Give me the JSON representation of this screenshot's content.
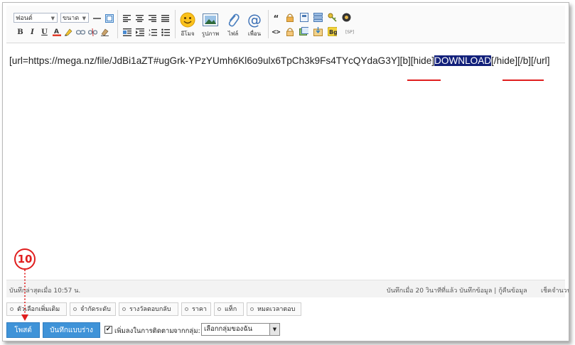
{
  "toolbar": {
    "font_select": "ฟอนต์",
    "size_select": "ขนาด",
    "emoticon_label": "อีโมจ",
    "image_label": "รูปภาพ",
    "file_label": "ไฟล์",
    "mention_label": "เพื่อน",
    "sp_label": "[SP]",
    "bg_label": "Bg"
  },
  "editor": {
    "code_before": "[url=https://mega.nz/file/JdBi1aZT#ugGrk-YPzYUmh6Kl6o9ulx6TpCh3k9Fs4TYcQYdaG3Y]",
    "tag_b_hide": "[b][hide]",
    "selected_text": "DOWNLOAD",
    "tag_close_hide_b": "[/hide][/b]",
    "tag_close_url": "[/url]"
  },
  "status": {
    "last_saved": "บันทึกล่าสุดเมื่อ 10:57 น.",
    "saved_info": "บันทึกเมื่อ 20 วินาทีที่แล้ว บันทึกข้อมูล | กู้คืนข้อมูล",
    "char_count": "เช็คจำนวน"
  },
  "options": [
    "ตัวเลือกเพิ่มเติม",
    "จำกัดระดับ",
    "รางวัลตอบกลับ",
    "ราคา",
    "แท็ก",
    "หมดเวลาตอบ"
  ],
  "actions": {
    "post_button": "โพสต์",
    "draft_button": "บันทึกแบบร่าง",
    "follow_checkbox_checked": true,
    "follow_label": "เพิ่มลงในการติดตาม",
    "group_label": "จากกลุ่ม:",
    "group_select": "เลือกกลุ่มของฉัน"
  },
  "annotation": {
    "step_number": "10"
  },
  "colors": {
    "accent": "#3f93d8",
    "highlight": "#12207a",
    "annotation_red": "#e01e1e"
  }
}
